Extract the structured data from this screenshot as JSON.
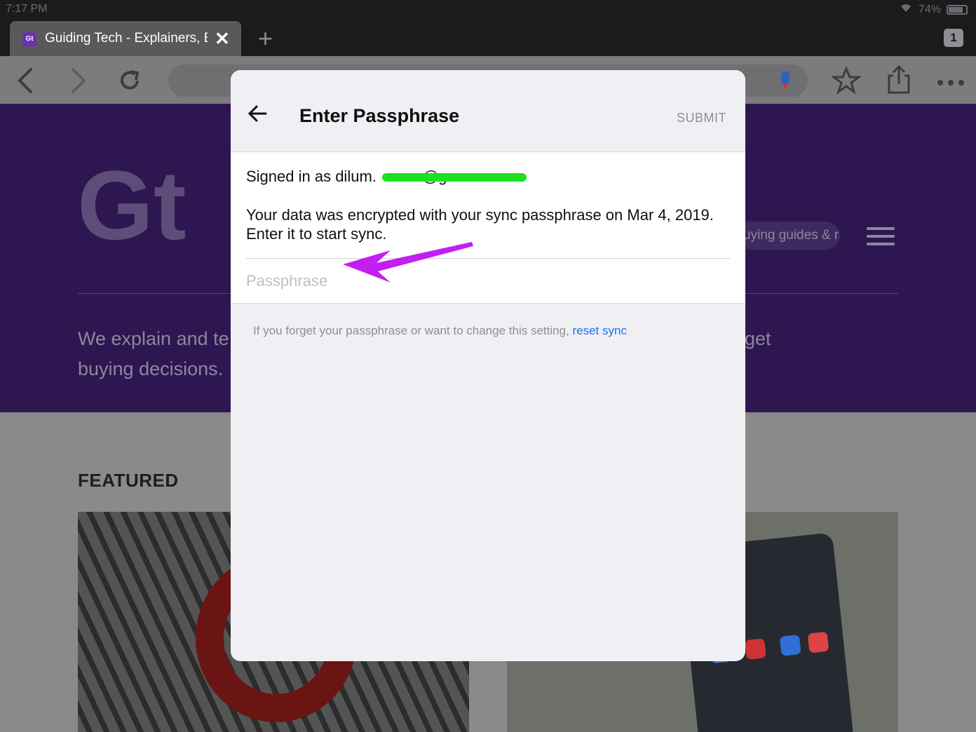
{
  "status_bar": {
    "time": "7:17 PM",
    "battery": "74%"
  },
  "tabs": {
    "active_title": "Guiding Tech - Explainers, B",
    "favicon_text": "Gt",
    "count": "1"
  },
  "website": {
    "logo_text": "Gt",
    "search_placeholder": "uying guides & r",
    "tagline_left_line1": "We explain and te",
    "tagline_left_line2": "buying decisions.",
    "tagline_right": "get",
    "featured_heading": "FEATURED"
  },
  "dialog": {
    "title": "Enter Passphrase",
    "submit_label": "SUBMIT",
    "signed_in_text": "Signed in as dilum.",
    "signed_in_suffix": "@g",
    "info_text": "Your data was encrypted with your sync passphrase on Mar 4, 2019. Enter it to start sync.",
    "passphrase_placeholder": "Passphrase",
    "footer_text": "If you forget your passphrase or want to change this setting, ",
    "reset_link": "reset sync"
  },
  "colors": {
    "hero_background": "#2e1650",
    "link_blue": "#1a73e8",
    "annotation_arrow": "#c21ff0",
    "redaction": "#1ee01e"
  },
  "icons": [
    "back-arrow-icon",
    "forward-arrow-icon",
    "reload-icon",
    "mic-icon",
    "star-icon",
    "share-icon",
    "more-icon",
    "close-icon",
    "new-tab-icon",
    "menu-icon",
    "wifi-icon"
  ]
}
